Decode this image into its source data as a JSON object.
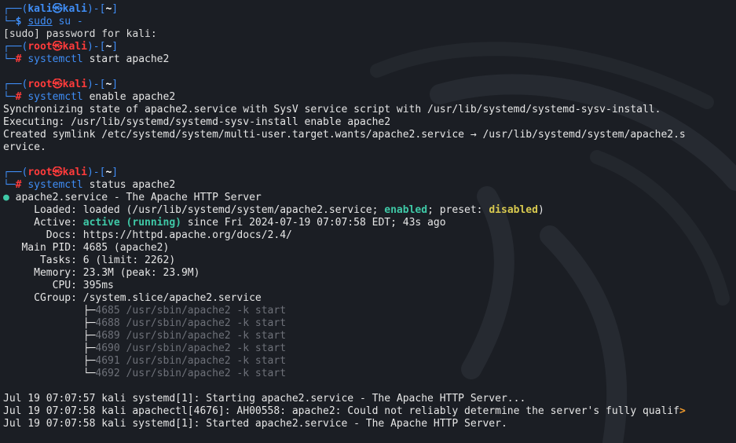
{
  "prompts": [
    {
      "user": "kali",
      "host": "kali",
      "at": "㉿",
      "dir": "~",
      "symbol": "$",
      "cmd": "sudo",
      "args": "su -"
    },
    {
      "user": "root",
      "host": "kali",
      "at": "㉿",
      "dir": "~",
      "symbol": "#",
      "cmd": "systemctl",
      "args": "start apache2"
    },
    {
      "user": "root",
      "host": "kali",
      "at": "㉿",
      "dir": "~",
      "symbol": "#",
      "cmd": "systemctl",
      "args": "enable apache2"
    },
    {
      "user": "root",
      "host": "kali",
      "at": "㉿",
      "dir": "~",
      "symbol": "#",
      "cmd": "systemctl",
      "args": "status apache2"
    }
  ],
  "output": {
    "sudo_password": "[sudo] password for kali:",
    "enable_lines": [
      "Synchronizing state of apache2.service with SysV service script with /usr/lib/systemd/systemd-sysv-install.",
      "Executing: /usr/lib/systemd/systemd-sysv-install enable apache2",
      "Created symlink /etc/systemd/system/multi-user.target.wants/apache2.service → /usr/lib/systemd/system/apache2.s",
      "ervice."
    ],
    "status": {
      "bullet": "●",
      "title": " apache2.service - The Apache HTTP Server",
      "loaded_label": "     Loaded: ",
      "loaded_pre": "loaded (/usr/lib/systemd/system/apache2.service; ",
      "loaded_enabled": "enabled",
      "loaded_mid": "; preset: ",
      "loaded_disabled": "disabled",
      "loaded_post": ")",
      "active_label": "     Active: ",
      "active_state": "active (running)",
      "active_since": " since Fri 2024-07-19 07:07:58 EDT; 43s ago",
      "docs": "       Docs: https://httpd.apache.org/docs/2.4/",
      "main_pid": "   Main PID: 4685 (apache2)",
      "tasks": "      Tasks: 6 (limit: 2262)",
      "memory": "     Memory: 23.3M (peak: 23.9M)",
      "cpu": "        CPU: 395ms",
      "cgroup": "     CGroup: /system.slice/apache2.service",
      "procs": [
        {
          "branch": "             ├─",
          "text": "4685 /usr/sbin/apache2 -k start"
        },
        {
          "branch": "             ├─",
          "text": "4688 /usr/sbin/apache2 -k start"
        },
        {
          "branch": "             ├─",
          "text": "4689 /usr/sbin/apache2 -k start"
        },
        {
          "branch": "             ├─",
          "text": "4690 /usr/sbin/apache2 -k start"
        },
        {
          "branch": "             ├─",
          "text": "4691 /usr/sbin/apache2 -k start"
        },
        {
          "branch": "             └─",
          "text": "4692 /usr/sbin/apache2 -k start"
        }
      ],
      "log": [
        "Jul 19 07:07:57 kali systemd[1]: Starting apache2.service - The Apache HTTP Server...",
        "Jul 19 07:07:58 kali apachectl[4676]: AH00558: apache2: Could not reliably determine the server's fully qualif",
        "Jul 19 07:07:58 kali systemd[1]: Started apache2.service - The Apache HTTP Server."
      ],
      "truncation_marker": ">"
    }
  },
  "colors": {
    "background": "#1b1e24",
    "prompt_frame": "#3f8df5",
    "root_user": "#ff3b3b",
    "enabled_green": "#3fc9a7",
    "disabled_yellow": "#d8c94f",
    "process_gray": "#6e7179",
    "truncation_orange": "#f09a2c"
  },
  "background_watermark": "kali-dragon-logo"
}
